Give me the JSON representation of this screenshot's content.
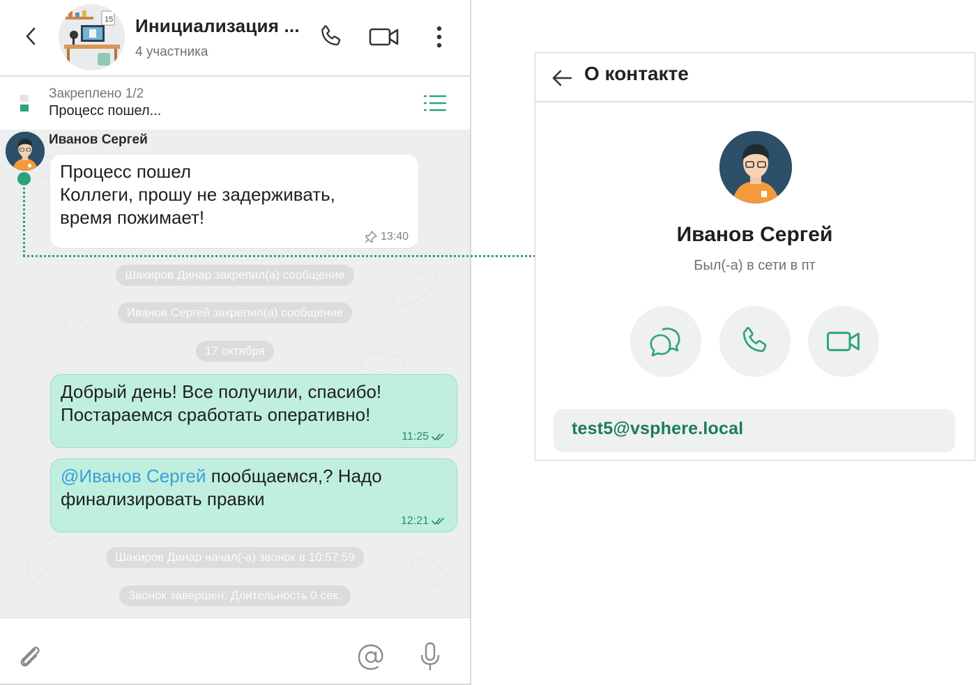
{
  "chat": {
    "title": "Инициализация ...",
    "subtitle": "4 участника",
    "pinned": {
      "label": "Закреплено 1/2",
      "text": "Процесс пошел..."
    },
    "messages": [
      {
        "sender": "Иванов Сергей",
        "text": "Процесс пошел\nКоллеги, прошу не задерживать,\nвремя пожимает!",
        "time": "13:40"
      },
      {
        "text": "Добрый день! Все получили, спасибо!\nПостараемся сработать оперативно!",
        "time": "11:25"
      },
      {
        "mention": "@Иванов Сергей",
        "text": " пообщаемся,? Надо\nфинализировать правки",
        "time": "12:21"
      }
    ],
    "system": {
      "pinned_1": "Шакиров Динар закрепил(а) сообщение",
      "pinned_2": "Иванов Сергей закрепил(а) сообщение",
      "date": "17 октября",
      "call_start": "Шакиров Динар начал(-а) звонок в 10:57:59",
      "call_end": "Звонок завершен. Длительность 0 сек."
    }
  },
  "contact": {
    "title": "О контакте",
    "name": "Иванов Сергей",
    "status": "Был(-а) в сети в пт",
    "email": "test5@vsphere.local"
  },
  "colors": {
    "accent": "#2aa37c",
    "outgoing_bubble": "#c0efdf",
    "mention": "#3aa0d8"
  },
  "icons": [
    "back-icon",
    "phone-icon",
    "video-icon",
    "more-icon",
    "pinned-list-icon",
    "pin-icon",
    "double-check-icon",
    "attach-icon",
    "at-icon",
    "mic-icon",
    "arrow-left-icon",
    "chat-bubbles-icon"
  ]
}
